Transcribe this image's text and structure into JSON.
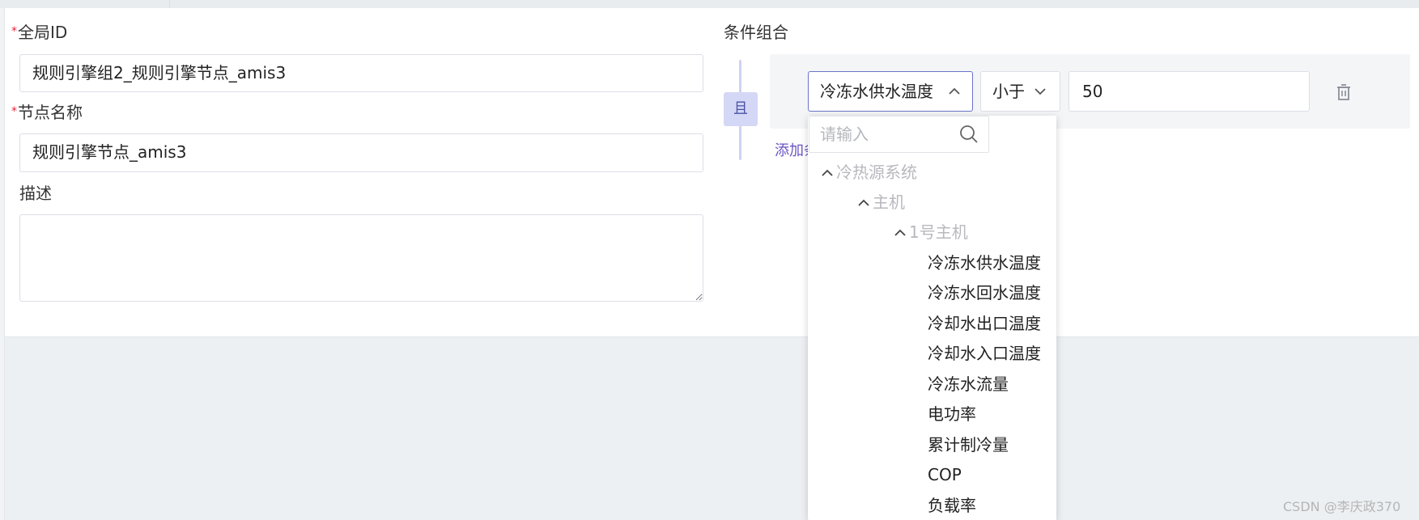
{
  "form": {
    "global_id_label": "全局ID",
    "global_id_value": "规则引擎组2_规则引擎节点_amis3",
    "node_name_label": "节点名称",
    "node_name_value": "规则引擎节点_amis3",
    "description_label": "描述",
    "description_value": "",
    "required_mark": "*"
  },
  "conditions": {
    "title": "条件组合",
    "and_label": "且",
    "field_value": "冷冻水供水温度",
    "operator_value": "小于",
    "compare_value": "50",
    "add_condition_label": "添加条件"
  },
  "dropdown": {
    "search_placeholder": "请输入",
    "tree": [
      {
        "label": "冷热源系统",
        "level": 0,
        "type": "group"
      },
      {
        "label": "主机",
        "level": 1,
        "type": "group"
      },
      {
        "label": "1号主机",
        "level": 2,
        "type": "group"
      },
      {
        "label": "冷冻水供水温度",
        "level": 3,
        "type": "leaf"
      },
      {
        "label": "冷冻水回水温度",
        "level": 3,
        "type": "leaf"
      },
      {
        "label": "冷却水出口温度",
        "level": 3,
        "type": "leaf"
      },
      {
        "label": "冷却水入口温度",
        "level": 3,
        "type": "leaf"
      },
      {
        "label": "冷冻水流量",
        "level": 3,
        "type": "leaf"
      },
      {
        "label": "电功率",
        "level": 3,
        "type": "leaf"
      },
      {
        "label": "累计制冷量",
        "level": 3,
        "type": "leaf"
      },
      {
        "label": "COP",
        "level": 3,
        "type": "leaf"
      },
      {
        "label": "负载率",
        "level": 3,
        "type": "leaf"
      }
    ]
  },
  "watermark": "CSDN @李庆政370",
  "colors": {
    "accent": "#6b73c9",
    "and_badge_bg": "#d4d7f5",
    "required": "#e0243a",
    "link": "#6b54c4"
  }
}
